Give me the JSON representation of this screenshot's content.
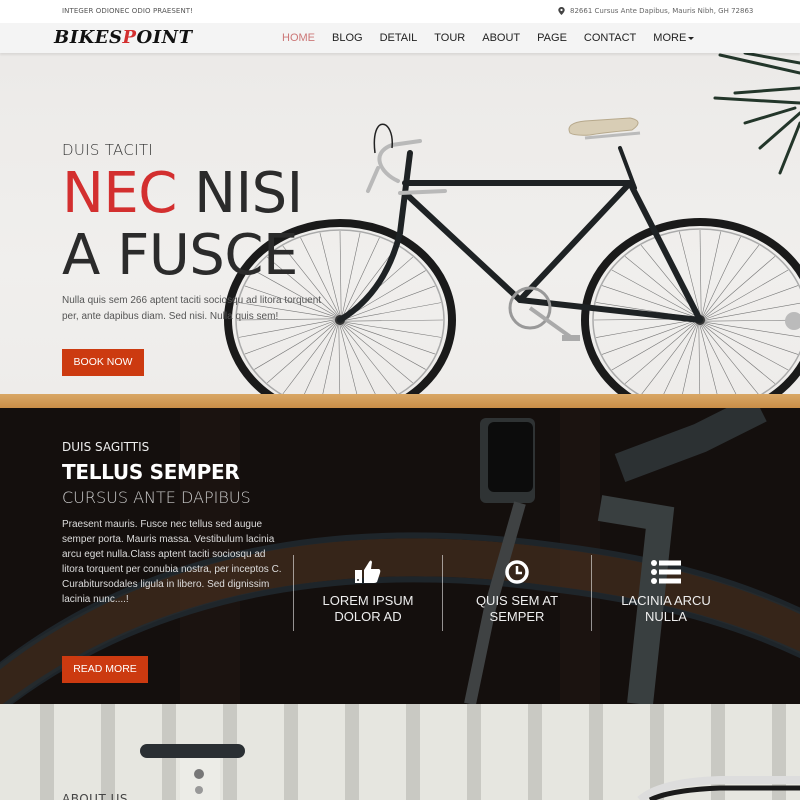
{
  "topbar": {
    "tagline": "INTEGER ODIONEC ODIO PRAESENT!",
    "address_icon": "map-marker-icon",
    "address": "82661 Cursus Ante Dapibus, Mauris Nibh, GH 72863"
  },
  "logo": {
    "part1": "BIKES",
    "part2": "P",
    "part3": "OINT"
  },
  "nav": {
    "items": [
      {
        "label": "HOME",
        "active": true
      },
      {
        "label": "BLOG"
      },
      {
        "label": "DETAIL"
      },
      {
        "label": "TOUR"
      },
      {
        "label": "ABOUT"
      },
      {
        "label": "PAGE"
      },
      {
        "label": "CONTACT"
      },
      {
        "label": "MORE",
        "dropdown": true
      }
    ]
  },
  "hero": {
    "subtitle": "DUIS TACITI",
    "title_red": "NEC",
    "title_rest": " NISI",
    "title_line2": "A FUSCE",
    "description": "Nulla quis sem 266 aptent taciti sociosqu ad litora torquent per, ante dapibus diam. Sed nisi. Nulla quis sem!",
    "button": "BOOK NOW"
  },
  "section2": {
    "subtitle": "DUIS SAGITTIS",
    "title": "TELLUS SEMPER",
    "subheading": "CURSUS ANTE DAPIBUS",
    "body": "Praesent mauris. Fusce nec tellus sed augue semper porta. Mauris massa. Vestibulum lacinia arcu eget nulla.Class aptent taciti sociosqu ad litora torquent per conubia nostra, per inceptos C. Curabitursodales ligula in libero. Sed dignissim lacinia nunc....!",
    "button": "READ MORE",
    "features": [
      {
        "icon": "thumbs-up-icon",
        "line1": "LOREM IPSUM",
        "line2": "DOLOR AD"
      },
      {
        "icon": "clock-icon",
        "line1": "QUIS SEM AT",
        "line2": "SEMPER"
      },
      {
        "icon": "list-icon",
        "line1": "LACINIA ARCU",
        "line2": "NULLA"
      }
    ]
  },
  "section3": {
    "heading": "ABOUT US"
  },
  "colors": {
    "accent_red": "#d32f2f",
    "button": "#cc3a10",
    "dark_bg": "#1b1412"
  }
}
